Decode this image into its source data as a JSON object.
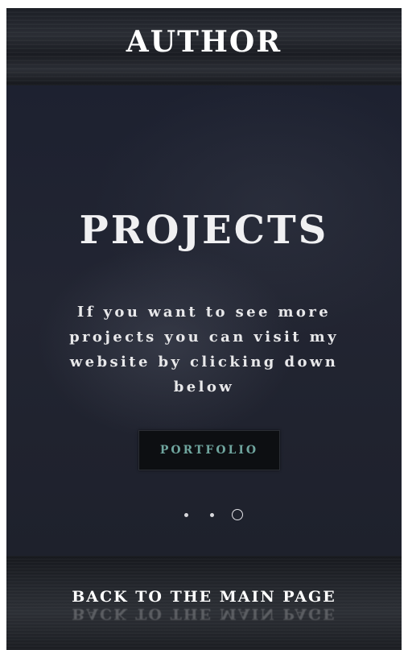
{
  "header": {
    "title": "AUTHOR"
  },
  "hero": {
    "title": "PROJECTS",
    "text": "If you want to see more projects you can visit my website by clicking down below",
    "button_label": "PORTFOLIO",
    "carousel": {
      "slide_count": 3,
      "active_index": 2
    }
  },
  "footer": {
    "back_label": "BACK TO THE MAIN PAGE"
  },
  "colors": {
    "background": "#14171f",
    "button_text": "#6fa59e",
    "text": "#ffffff"
  }
}
